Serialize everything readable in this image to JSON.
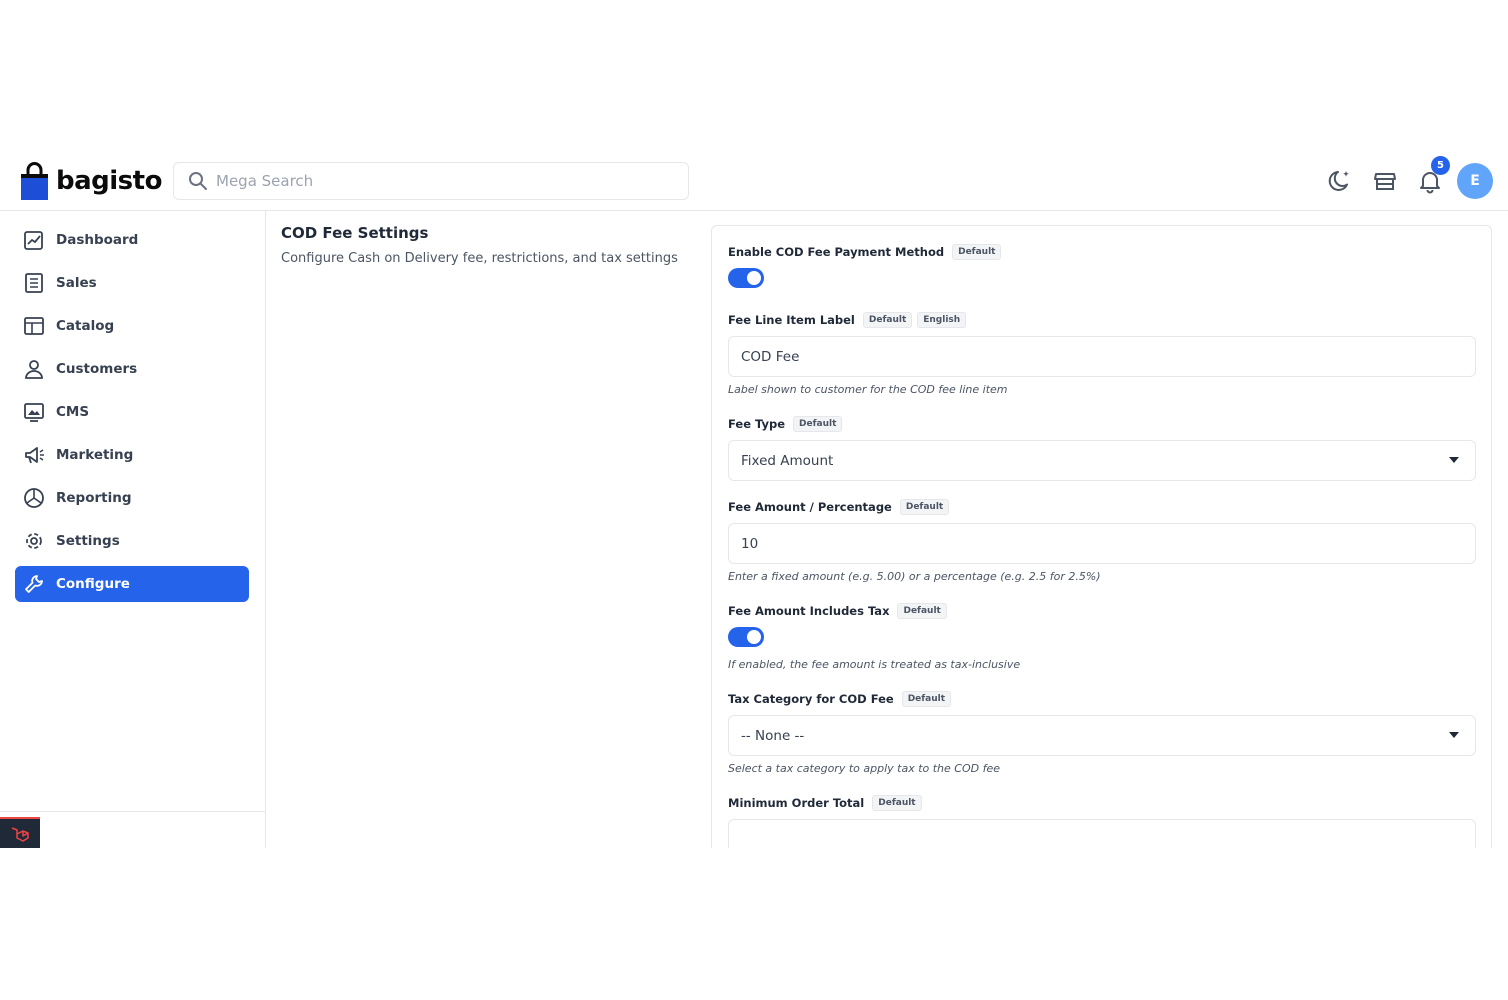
{
  "header": {
    "logo_text": "bagisto",
    "search_placeholder": "Mega Search",
    "notification_count": "5",
    "avatar_initial": "E"
  },
  "sidebar": {
    "items": [
      {
        "label": "Dashboard",
        "icon": "dashboard-icon"
      },
      {
        "label": "Sales",
        "icon": "sales-icon"
      },
      {
        "label": "Catalog",
        "icon": "catalog-icon"
      },
      {
        "label": "Customers",
        "icon": "customers-icon"
      },
      {
        "label": "CMS",
        "icon": "cms-icon"
      },
      {
        "label": "Marketing",
        "icon": "megaphone-icon"
      },
      {
        "label": "Reporting",
        "icon": "pie-chart-icon"
      },
      {
        "label": "Settings",
        "icon": "gear-icon"
      },
      {
        "label": "Configure",
        "icon": "wrench-icon",
        "active": true
      }
    ]
  },
  "section": {
    "title": "COD Fee Settings",
    "description": "Configure Cash on Delivery fee, restrictions, and tax settings"
  },
  "fields": {
    "enable": {
      "label": "Enable COD Fee Payment Method",
      "tag": "Default",
      "value": true
    },
    "line_label": {
      "label": "Fee Line Item Label",
      "tag": "Default",
      "tag2": "English",
      "value": "COD Fee",
      "help": "Label shown to customer for the COD fee line item"
    },
    "fee_type": {
      "label": "Fee Type",
      "tag": "Default",
      "value": "Fixed Amount"
    },
    "fee_amount": {
      "label": "Fee Amount / Percentage",
      "tag": "Default",
      "value": "10",
      "help": "Enter a fixed amount (e.g. 5.00) or a percentage (e.g. 2.5 for 2.5%)"
    },
    "includes_tax": {
      "label": "Fee Amount Includes Tax",
      "tag": "Default",
      "value": true,
      "help": "If enabled, the fee amount is treated as tax-inclusive"
    },
    "tax_category": {
      "label": "Tax Category for COD Fee",
      "tag": "Default",
      "value": "-- None --",
      "help": "Select a tax category to apply tax to the COD fee"
    },
    "min_order": {
      "label": "Minimum Order Total",
      "tag": "Default",
      "value": ""
    }
  },
  "colors": {
    "accent": "#2563eb",
    "avatar": "#60a5fa",
    "border": "#e5e7eb"
  }
}
